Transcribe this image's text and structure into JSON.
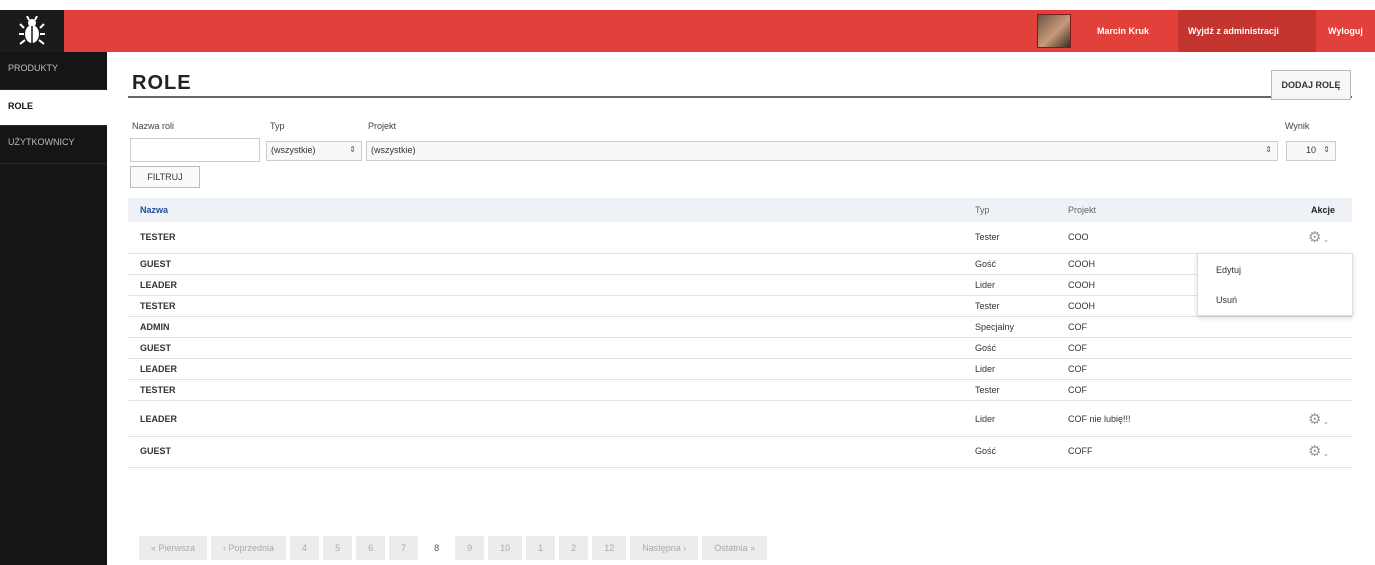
{
  "topbar": {
    "user": "Marcin Kruk",
    "admin": "Wyjdź z administracji",
    "logout": "Wyloguj"
  },
  "sidebar": {
    "items": [
      {
        "label": "PRODUKTY"
      },
      {
        "label": "ROLE"
      },
      {
        "label": "UŻYTKOWNICY"
      }
    ]
  },
  "page": {
    "title": "ROLE",
    "add_button": "DODAJ ROLĘ"
  },
  "filters": {
    "name_label": "Nazwa roli",
    "type_label": "Typ",
    "project_label": "Projekt",
    "per_page_label": "Wynik",
    "type_value": "(wszystkie)",
    "project_value": "(wszystkie)",
    "per_page_value": "10",
    "filter_button": "FILTRUJ"
  },
  "table": {
    "headers": {
      "name": "Nazwa",
      "type": "Typ",
      "project": "Projekt",
      "actions": "Akcje"
    },
    "rows": [
      {
        "name": "TESTER",
        "type": "Tester",
        "project": "COO"
      },
      {
        "name": "GUEST",
        "type": "Gość",
        "project": "COOH"
      },
      {
        "name": "LEADER",
        "type": "Lider",
        "project": "COOH"
      },
      {
        "name": "TESTER",
        "type": "Tester",
        "project": "COOH"
      },
      {
        "name": "ADMIN",
        "type": "Specjalny",
        "project": "COF"
      },
      {
        "name": "GUEST",
        "type": "Gość",
        "project": "COF"
      },
      {
        "name": "LEADER",
        "type": "Lider",
        "project": "COF"
      },
      {
        "name": "TESTER",
        "type": "Tester",
        "project": "COF"
      },
      {
        "name": "LEADER",
        "type": "Lider",
        "project": "COF nie lubię!!!"
      },
      {
        "name": "GUEST",
        "type": "Gość",
        "project": "COFF"
      }
    ]
  },
  "dropdown": {
    "edit": "Edytuj",
    "delete": "Usuń"
  },
  "pagination": {
    "items": [
      "« Pierwsza",
      "‹ Poprzednia",
      "4",
      "5",
      "6",
      "7",
      "8",
      "9",
      "10",
      "1",
      "2",
      "12",
      "Następna ›",
      "Ostatnia »"
    ],
    "current_index": 6
  },
  "colors": {
    "topbar": "#e2403a",
    "sidebar": "#151515",
    "header_row": "#eef1f6"
  }
}
